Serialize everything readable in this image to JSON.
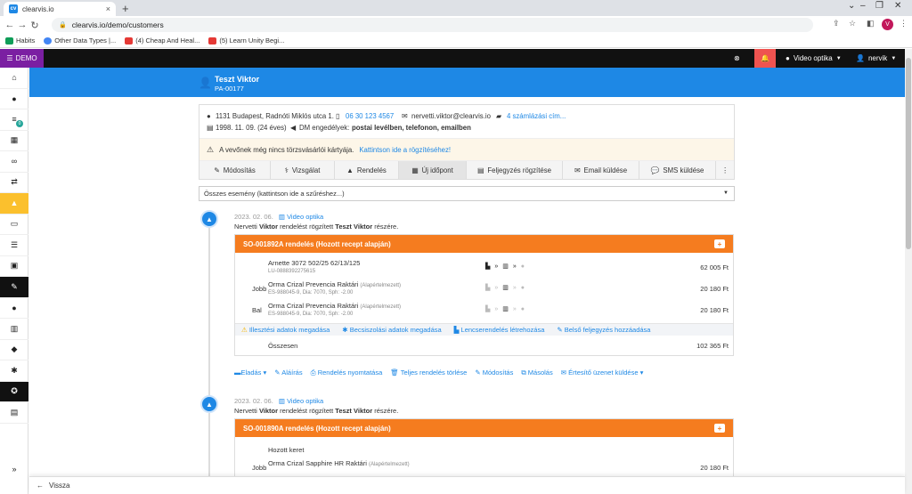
{
  "browser": {
    "tab_title": "clearvis.io",
    "url": "clearvis.io/demo/customers",
    "profile_initial": "V",
    "bookmarks": [
      {
        "label": "Habits",
        "color": "#0f9d58"
      },
      {
        "label": "Other Data Types |...",
        "color": "#4285f4"
      },
      {
        "label": "(4) Cheap And Heal...",
        "color": "#e53935"
      },
      {
        "label": "(5) Learn Unity Begi...",
        "color": "#e53935"
      }
    ]
  },
  "appbar": {
    "demo_label": "DEMO",
    "store_label": "Video optika",
    "user_label": "nervik"
  },
  "sidebar": {
    "badge": "0",
    "icons": [
      "home-icon",
      "user-icon",
      "list-icon",
      "calendar-icon",
      "glasses-icon",
      "exchange-icon",
      "shopping-bag-icon",
      "money-icon",
      "list-lines-icon",
      "briefcase-icon",
      "wrench-icon",
      "person-icon",
      "building-icon",
      "tag-icon",
      "gear-icon",
      "soccer-icon",
      "archive-icon",
      "chevron-right-icon"
    ]
  },
  "customer": {
    "name": "Teszt Viktor",
    "id": "PA-00177",
    "address": "1131 Budapest, Radnóti Miklós utca 1.",
    "phone": "06 30 123 4567",
    "email": "nervetti.viktor@clearvis.io",
    "billing": "4 számlázási cím...",
    "birth": "1998. 11. 09. (24 éves)",
    "dm_label": "DM engedélyek:",
    "dm_value": "postai levélben, telefonon, emailben",
    "warning_text": "A vevőnek még nincs törzsvásárlói kártyája.",
    "warning_link": "Kattintson ide a rögzítéséhez!"
  },
  "actions": [
    "Módosítás",
    "Vizsgálat",
    "Rendelés",
    "Új időpont",
    "Feljegyzés rögzítése",
    "Email küldése",
    "SMS küldése"
  ],
  "filter": "Összes esemény (kattintson ide a szűréshez...)",
  "events": [
    {
      "date": "2023. 02. 06.",
      "store": "Video optika",
      "desc_prefix": "Nervetti",
      "desc_bold": "Viktor",
      "desc_mid": "rendelést rögzített",
      "desc_target": "Teszt Viktor",
      "desc_suffix": "részére.",
      "order_title": "SO-001892A rendelés (Hozott recept alapján)",
      "items": [
        {
          "side": "",
          "name": "Arnette 3072 502/25 62/13/125",
          "tag": "",
          "code": "LU-0888392275615",
          "price": "62 005 Ft"
        },
        {
          "side": "Jobb",
          "name": "Orma Crizal Prevencia Raktári",
          "tag": "(Alapértelmezett)",
          "code": "ES-988045-9, Dia: 7070, Sph: -2.00",
          "price": "20 180 Ft"
        },
        {
          "side": "Bal",
          "name": "Orma Crizal Prevencia Raktári",
          "tag": "(Alapértelmezett)",
          "code": "ES-988045-9, Dia: 7070, Sph: -2.00",
          "price": "20 180 Ft"
        }
      ],
      "notes": [
        "Illesztési adatok megadása",
        "Becsiszolási adatok megadása",
        "Lencserendelés létrehozása",
        "Belső feljegyzés hozzáadása"
      ],
      "total_label": "Összesen",
      "total_value": "102 365 Ft",
      "footer_actions": [
        "Eladás",
        "Aláírás",
        "Rendelés nyomtatása",
        "Teljes rendelés törlése",
        "Módosítás",
        "Másolás",
        "Értesítő üzenet küldése"
      ]
    },
    {
      "date": "2023. 02. 06.",
      "store": "Video optika",
      "desc_prefix": "Nervetti",
      "desc_bold": "Viktor",
      "desc_mid": "rendelést rögzített",
      "desc_target": "Teszt Viktor",
      "desc_suffix": "részére.",
      "order_title": "SO-001890A rendelés (Hozott recept alapján)",
      "frame_label": "Hozott keret",
      "items": [
        {
          "side": "Jobb",
          "name": "Orma Crizal Sapphire HR Raktári",
          "tag": "(Alapértelmezett)",
          "code": "",
          "price": "20 180 Ft"
        }
      ]
    }
  ],
  "bottom": {
    "back_label": "Vissza"
  },
  "colors": {
    "brand_blue": "#1e88e5",
    "order_orange": "#f57c1f",
    "demo_purple": "#7b1fa2",
    "active_yellow": "#fbc02d"
  }
}
